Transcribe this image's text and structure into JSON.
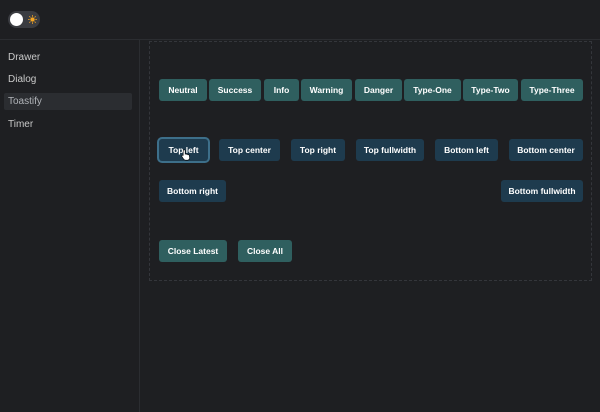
{
  "theme_toggle": {
    "knob": "toggle-knob",
    "icon": "sun-icon",
    "icon_color": "#f5a623"
  },
  "sidebar": {
    "items": [
      {
        "label": "Drawer"
      },
      {
        "label": "Dialog"
      },
      {
        "label": "Toastify",
        "active": true
      },
      {
        "label": "Timer"
      }
    ]
  },
  "toast_types": [
    "Neutral",
    "Success",
    "Info",
    "Warning",
    "Danger",
    "Type-One",
    "Type-Two",
    "Type-Three"
  ],
  "positions": [
    "Top left",
    "Top center",
    "Top right",
    "Top fullwidth",
    "Bottom left",
    "Bottom center",
    "Bottom right",
    "Bottom fullwidth"
  ],
  "actions": [
    "Close Latest",
    "Close All"
  ],
  "colors": {
    "background": "#1e1f22",
    "type_button": "#2f5f5f",
    "position_button": "#1e3b4e",
    "focus_ring": "#3d6f8a"
  },
  "cursor": {
    "icon": "hand-pointer-icon"
  }
}
